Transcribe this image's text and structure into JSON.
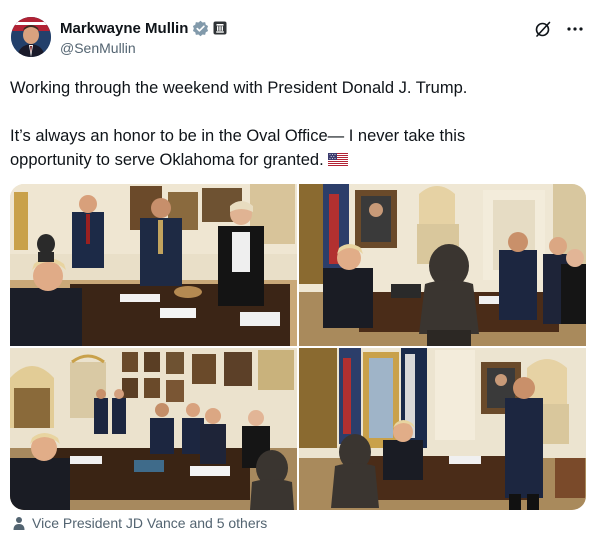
{
  "post": {
    "author_name": "Markwayne Mullin",
    "handle": "@SenMullin",
    "line1": "Working through the weekend with President Donald J. Trump.",
    "line2": "It’s always an honor to be in the Oval Office— I never take this",
    "line3": "opportunity to serve Oklahoma for granted.",
    "tagged": "Vice President JD Vance and 5 others"
  },
  "icons": [
    "verified-badge-icon",
    "government-badge-icon",
    "grok-icon",
    "more-icon",
    "us-flag-icon",
    "person-icon"
  ],
  "colors": {
    "verified_blue": "#1d9bf0",
    "secondary_text": "#536471"
  }
}
